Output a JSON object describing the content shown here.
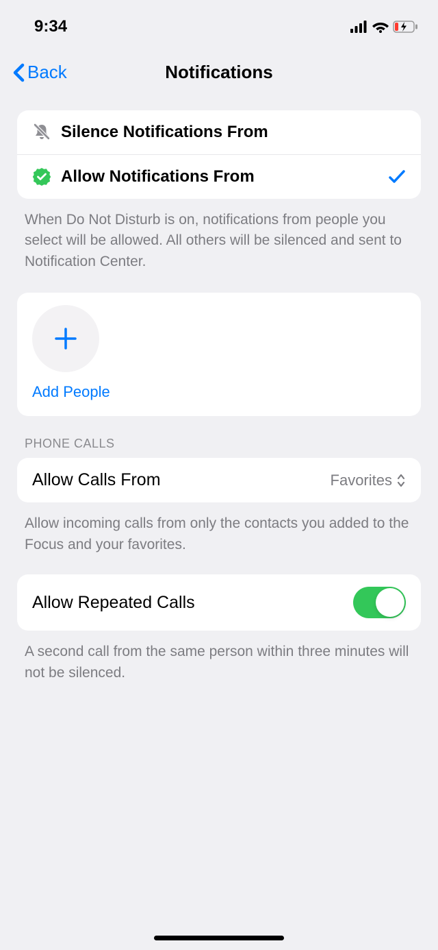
{
  "status": {
    "time": "9:34"
  },
  "nav": {
    "back": "Back",
    "title": "Notifications"
  },
  "notif_mode": {
    "silence": "Silence Notifications From",
    "allow": "Allow Notifications From",
    "footer": "When Do Not Disturb is on, notifications from people you select will be allowed. All others will be silenced and sent to Notification Center."
  },
  "add": {
    "label": "Add People"
  },
  "phone_calls": {
    "header": "Phone Calls",
    "allow_from_label": "Allow Calls From",
    "allow_from_value": "Favorites",
    "allow_from_footer": "Allow incoming calls from only the contacts you added to the Focus and your favorites.",
    "repeated_label": "Allow Repeated Calls",
    "repeated_footer": "A second call from the same person within three minutes will not be silenced."
  }
}
